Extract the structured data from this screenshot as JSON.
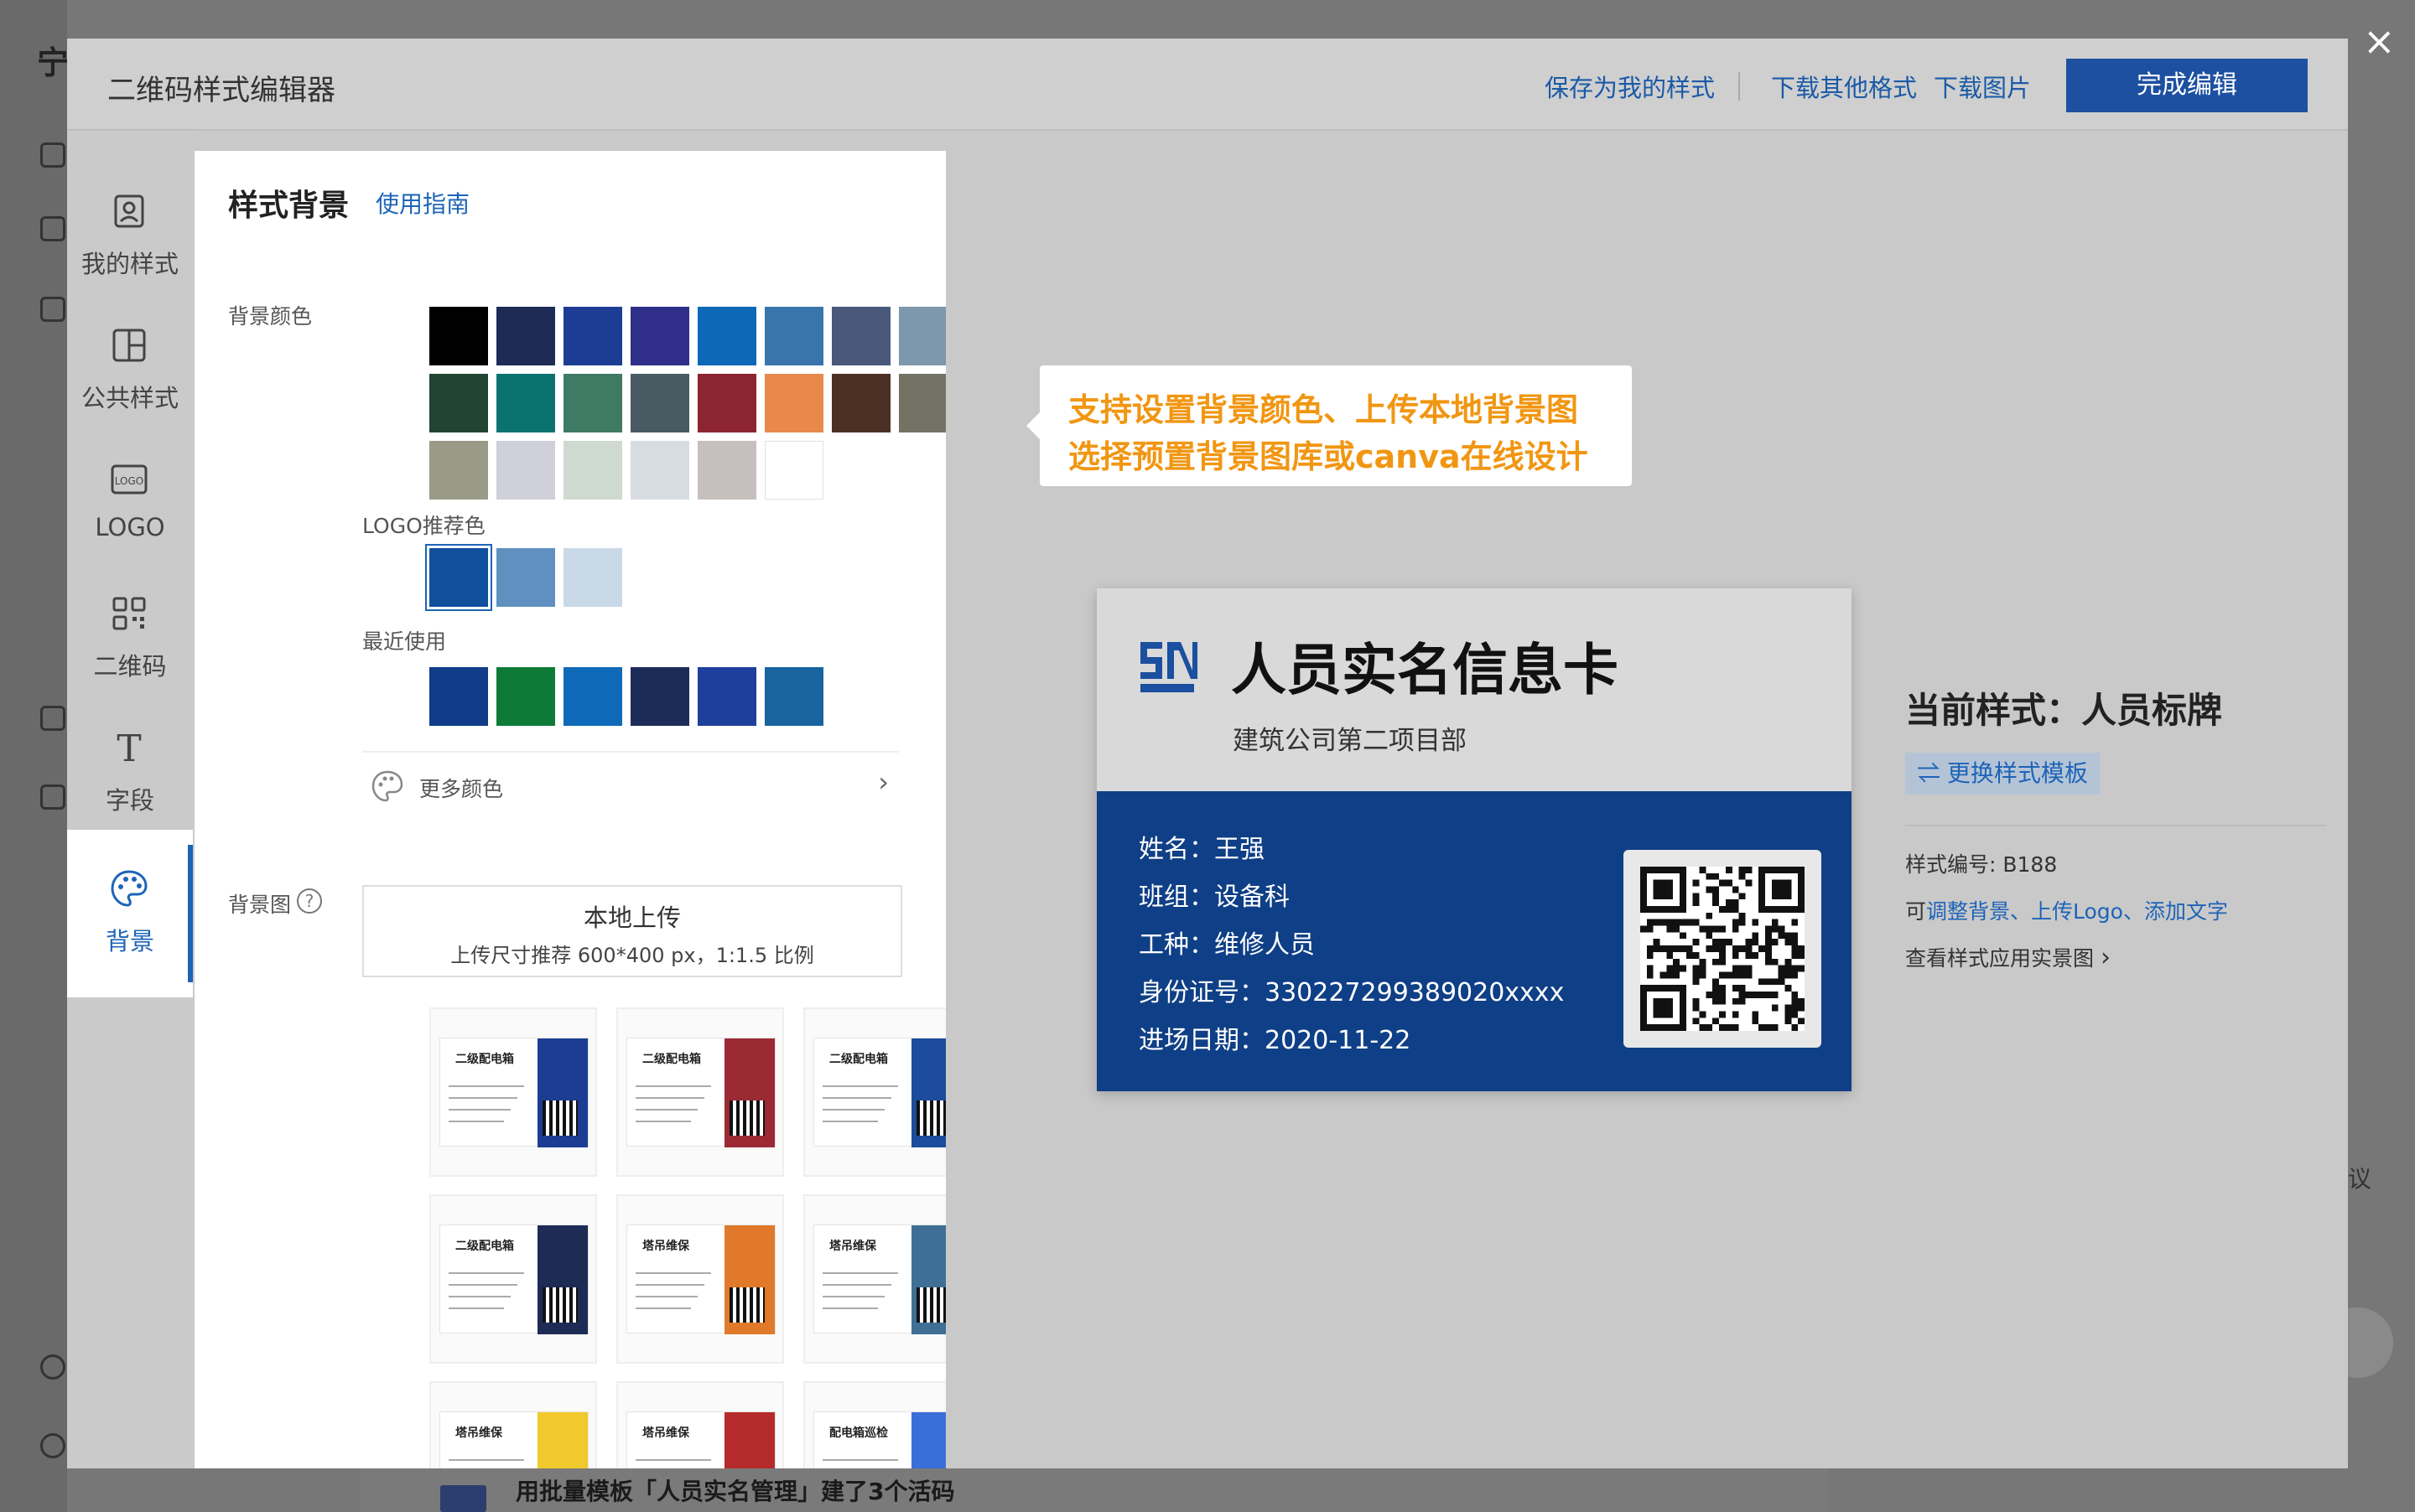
{
  "background_page": {
    "corner_char": "宁",
    "bottom_text": "用批量模板「人员实名管理」建了3个活码",
    "right_edge_text": "议"
  },
  "close_icon": "×",
  "modal": {
    "title": "二维码样式编辑器",
    "header": {
      "save_style": "保存为我的样式",
      "download_other": "下载其他格式",
      "download_image": "下载图片",
      "finish": "完成编辑"
    },
    "nav": [
      {
        "label": "我的样式",
        "icon": "my-style-icon"
      },
      {
        "label": "公共样式",
        "icon": "public-style-icon"
      },
      {
        "label": "LOGO",
        "icon": "logo-icon"
      },
      {
        "label": "二维码",
        "icon": "qrcode-icon"
      },
      {
        "label": "字段",
        "icon": "text-field-icon"
      },
      {
        "label": "背景",
        "icon": "palette-icon"
      }
    ],
    "panel": {
      "title": "样式背景",
      "guide_link": "使用指南",
      "bg_color_label": "背景颜色",
      "bg_colors": [
        "#000000",
        "#1d2b55",
        "#1c3d93",
        "#2f2f8a",
        "#0e68b8",
        "#3a74ad",
        "#4a587c",
        "#7d97ad",
        "#214532",
        "#0a7370",
        "#3e7a64",
        "#495a62",
        "#8c2530",
        "#e8894b",
        "#4c3024",
        "#747264",
        "#999b88",
        "#cfd0d9",
        "#ced9d0",
        "#d7dce3",
        "#c7bfbd",
        "#ffffff"
      ],
      "logo_color_label": "LOGO推荐色",
      "logo_colors": [
        "#0f4f9c",
        "#5f90bf",
        "#cad9e8"
      ],
      "recent_label": "最近使用",
      "recent_colors": [
        "#103c8a",
        "#0e7a38",
        "#0e6ab8",
        "#1d2b58",
        "#1f3f9c",
        "#17649e"
      ],
      "more_colors": "更多颜色",
      "bg_image_label": "背景图",
      "help_icon": "?",
      "upload_title": "本地上传",
      "upload_hint": "上传尺寸推荐 600*400 px，1:1.5 比例",
      "templates": [
        {
          "title": "二级配电箱",
          "accent": "#1c3d93"
        },
        {
          "title": "二级配电箱",
          "accent": "#9b2a35"
        },
        {
          "title": "二级配电箱",
          "accent": "#1c4c9b"
        },
        {
          "title": "二级配电箱",
          "accent": "#1d2b55"
        },
        {
          "title": "塔吊维保",
          "accent": "#e07a2a"
        },
        {
          "title": "塔吊维保",
          "accent": "#3f6f94"
        },
        {
          "title": "塔吊维保",
          "accent": "#f2c92c"
        },
        {
          "title": "塔吊维保",
          "accent": "#b52a2a"
        },
        {
          "title": "配电箱巡检",
          "accent": "#3a6fd8"
        }
      ]
    },
    "tooltip": {
      "line1": "支持设置背景颜色、上传本地背景图",
      "line2": "选择预置背景图库或canva在线设计"
    },
    "card": {
      "title": "人员实名信息卡",
      "subtitle": "建筑公司第二项目部",
      "fields": [
        "姓名：王强",
        "班组：设备科",
        "工种：维修人员",
        "身份证号：330227299389020xxxx",
        "进场日期：2020-11-22"
      ]
    },
    "info": {
      "current_style": "当前样式：人员标牌",
      "switch_template": "⇌ 更换样式模板",
      "style_no": "样式编号: B188",
      "can_prefix": "可",
      "can_links": "调整背景、上传Logo、添加文字",
      "view_real": "查看样式应用实景图",
      "view_chevron": "›"
    }
  }
}
